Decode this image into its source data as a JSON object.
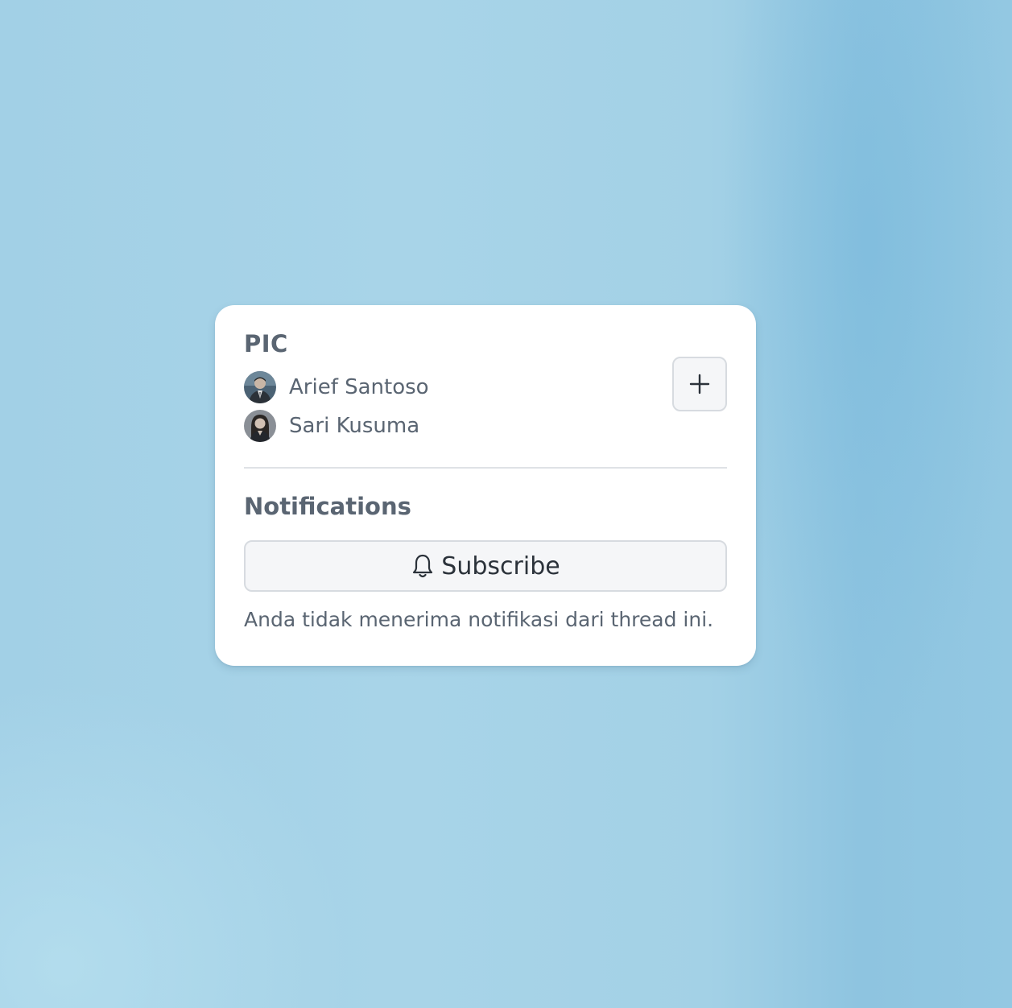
{
  "pic": {
    "title": "PIC",
    "assignees": [
      {
        "name": "Arief Santoso",
        "avatar": "avatar-man-suit"
      },
      {
        "name": "Sari Kusuma",
        "avatar": "avatar-woman"
      }
    ],
    "add_icon": "plus-icon"
  },
  "notifications": {
    "title": "Notifications",
    "subscribe_label": "Subscribe",
    "subscribe_icon": "bell-icon",
    "description": "Anda tidak menerima notifikasi dari thread ini."
  },
  "colors": {
    "card_background": "#ffffff",
    "heading_text": "#5a6572",
    "button_background": "#f5f6f8",
    "button_border": "#d7dbe0",
    "button_text": "#2b323a"
  }
}
